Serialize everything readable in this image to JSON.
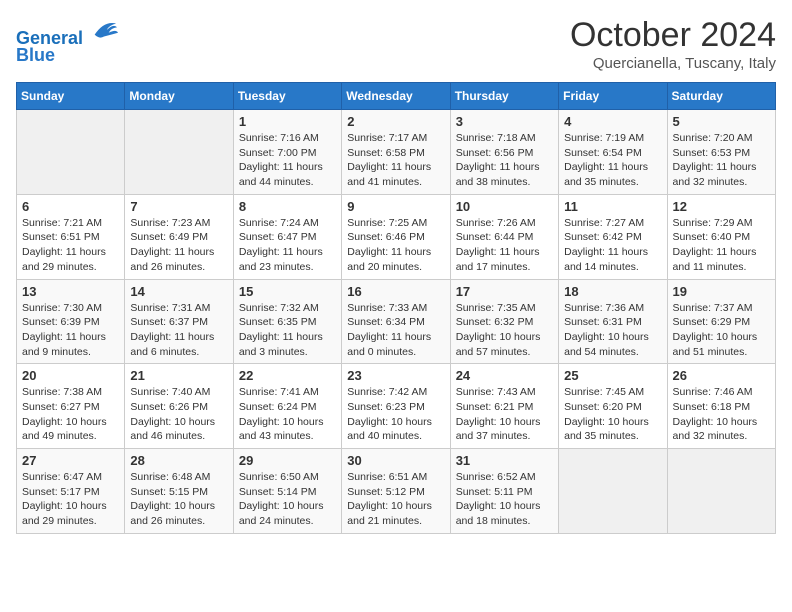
{
  "header": {
    "logo_line1": "General",
    "logo_line2": "Blue",
    "month": "October 2024",
    "location": "Quercianella, Tuscany, Italy"
  },
  "days_of_week": [
    "Sunday",
    "Monday",
    "Tuesday",
    "Wednesday",
    "Thursday",
    "Friday",
    "Saturday"
  ],
  "weeks": [
    [
      {
        "day": "",
        "info": ""
      },
      {
        "day": "",
        "info": ""
      },
      {
        "day": "1",
        "info": "Sunrise: 7:16 AM\nSunset: 7:00 PM\nDaylight: 11 hours and 44 minutes."
      },
      {
        "day": "2",
        "info": "Sunrise: 7:17 AM\nSunset: 6:58 PM\nDaylight: 11 hours and 41 minutes."
      },
      {
        "day": "3",
        "info": "Sunrise: 7:18 AM\nSunset: 6:56 PM\nDaylight: 11 hours and 38 minutes."
      },
      {
        "day": "4",
        "info": "Sunrise: 7:19 AM\nSunset: 6:54 PM\nDaylight: 11 hours and 35 minutes."
      },
      {
        "day": "5",
        "info": "Sunrise: 7:20 AM\nSunset: 6:53 PM\nDaylight: 11 hours and 32 minutes."
      }
    ],
    [
      {
        "day": "6",
        "info": "Sunrise: 7:21 AM\nSunset: 6:51 PM\nDaylight: 11 hours and 29 minutes."
      },
      {
        "day": "7",
        "info": "Sunrise: 7:23 AM\nSunset: 6:49 PM\nDaylight: 11 hours and 26 minutes."
      },
      {
        "day": "8",
        "info": "Sunrise: 7:24 AM\nSunset: 6:47 PM\nDaylight: 11 hours and 23 minutes."
      },
      {
        "day": "9",
        "info": "Sunrise: 7:25 AM\nSunset: 6:46 PM\nDaylight: 11 hours and 20 minutes."
      },
      {
        "day": "10",
        "info": "Sunrise: 7:26 AM\nSunset: 6:44 PM\nDaylight: 11 hours and 17 minutes."
      },
      {
        "day": "11",
        "info": "Sunrise: 7:27 AM\nSunset: 6:42 PM\nDaylight: 11 hours and 14 minutes."
      },
      {
        "day": "12",
        "info": "Sunrise: 7:29 AM\nSunset: 6:40 PM\nDaylight: 11 hours and 11 minutes."
      }
    ],
    [
      {
        "day": "13",
        "info": "Sunrise: 7:30 AM\nSunset: 6:39 PM\nDaylight: 11 hours and 9 minutes."
      },
      {
        "day": "14",
        "info": "Sunrise: 7:31 AM\nSunset: 6:37 PM\nDaylight: 11 hours and 6 minutes."
      },
      {
        "day": "15",
        "info": "Sunrise: 7:32 AM\nSunset: 6:35 PM\nDaylight: 11 hours and 3 minutes."
      },
      {
        "day": "16",
        "info": "Sunrise: 7:33 AM\nSunset: 6:34 PM\nDaylight: 11 hours and 0 minutes."
      },
      {
        "day": "17",
        "info": "Sunrise: 7:35 AM\nSunset: 6:32 PM\nDaylight: 10 hours and 57 minutes."
      },
      {
        "day": "18",
        "info": "Sunrise: 7:36 AM\nSunset: 6:31 PM\nDaylight: 10 hours and 54 minutes."
      },
      {
        "day": "19",
        "info": "Sunrise: 7:37 AM\nSunset: 6:29 PM\nDaylight: 10 hours and 51 minutes."
      }
    ],
    [
      {
        "day": "20",
        "info": "Sunrise: 7:38 AM\nSunset: 6:27 PM\nDaylight: 10 hours and 49 minutes."
      },
      {
        "day": "21",
        "info": "Sunrise: 7:40 AM\nSunset: 6:26 PM\nDaylight: 10 hours and 46 minutes."
      },
      {
        "day": "22",
        "info": "Sunrise: 7:41 AM\nSunset: 6:24 PM\nDaylight: 10 hours and 43 minutes."
      },
      {
        "day": "23",
        "info": "Sunrise: 7:42 AM\nSunset: 6:23 PM\nDaylight: 10 hours and 40 minutes."
      },
      {
        "day": "24",
        "info": "Sunrise: 7:43 AM\nSunset: 6:21 PM\nDaylight: 10 hours and 37 minutes."
      },
      {
        "day": "25",
        "info": "Sunrise: 7:45 AM\nSunset: 6:20 PM\nDaylight: 10 hours and 35 minutes."
      },
      {
        "day": "26",
        "info": "Sunrise: 7:46 AM\nSunset: 6:18 PM\nDaylight: 10 hours and 32 minutes."
      }
    ],
    [
      {
        "day": "27",
        "info": "Sunrise: 6:47 AM\nSunset: 5:17 PM\nDaylight: 10 hours and 29 minutes."
      },
      {
        "day": "28",
        "info": "Sunrise: 6:48 AM\nSunset: 5:15 PM\nDaylight: 10 hours and 26 minutes."
      },
      {
        "day": "29",
        "info": "Sunrise: 6:50 AM\nSunset: 5:14 PM\nDaylight: 10 hours and 24 minutes."
      },
      {
        "day": "30",
        "info": "Sunrise: 6:51 AM\nSunset: 5:12 PM\nDaylight: 10 hours and 21 minutes."
      },
      {
        "day": "31",
        "info": "Sunrise: 6:52 AM\nSunset: 5:11 PM\nDaylight: 10 hours and 18 minutes."
      },
      {
        "day": "",
        "info": ""
      },
      {
        "day": "",
        "info": ""
      }
    ]
  ]
}
